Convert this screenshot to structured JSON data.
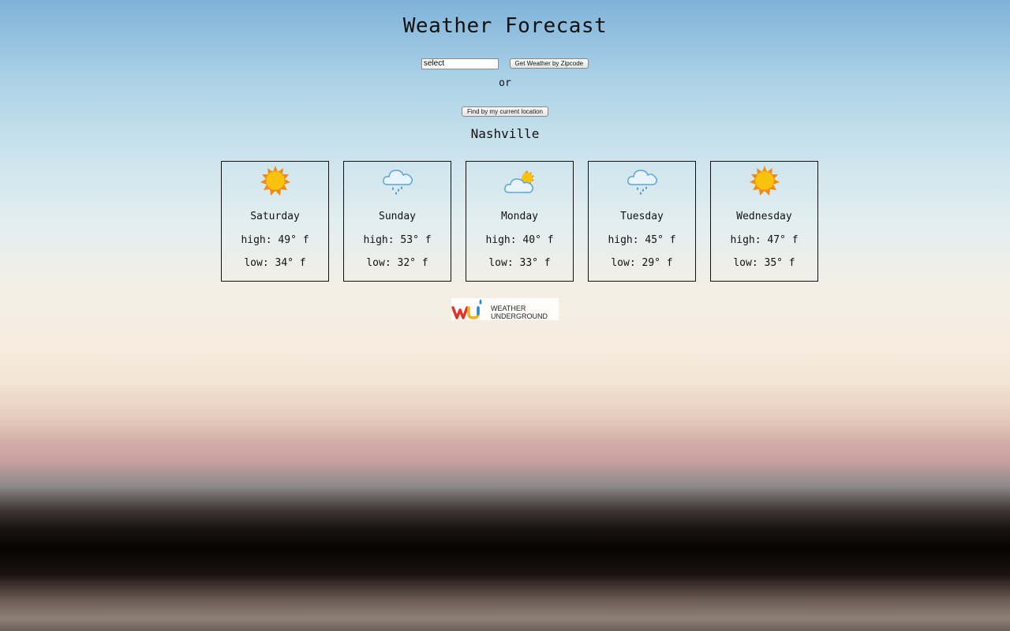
{
  "header": {
    "title": "Weather Forecast"
  },
  "search": {
    "zip_value": "select",
    "submit_label": "Get Weather by Zipcode",
    "or_text": "or",
    "location_label": "Find by my current location"
  },
  "location": {
    "city": "Nashville"
  },
  "forecast": [
    {
      "day": "Saturday",
      "high": "high: 49° f",
      "low": "low: 34° f",
      "icon": "sunny-icon"
    },
    {
      "day": "Sunday",
      "high": "high: 53° f",
      "low": "low: 32° f",
      "icon": "rain-cloud-icon"
    },
    {
      "day": "Monday",
      "high": "high: 40° f",
      "low": "low: 33° f",
      "icon": "partly-cloudy-icon"
    },
    {
      "day": "Tuesday",
      "high": "high: 45° f",
      "low": "low: 29° f",
      "icon": "rain-cloud-icon"
    },
    {
      "day": "Wednesday",
      "high": "high: 47° f",
      "low": "low: 35° f",
      "icon": "sunny-icon"
    }
  ],
  "footer": {
    "logo_line1": "WEATHER",
    "logo_line2": "UNDERGROUND",
    "logo_initials": "wu"
  },
  "colors": {
    "sun": "#f9c20c",
    "sun_rays": "#f08a12",
    "cloud": "#e8f3fb",
    "cloud_outline": "#5aa6d6",
    "rain": "#3d8fd0",
    "wu_red": "#e0342a",
    "wu_yellow": "#f5b119",
    "wu_blue": "#1f8ad6"
  }
}
